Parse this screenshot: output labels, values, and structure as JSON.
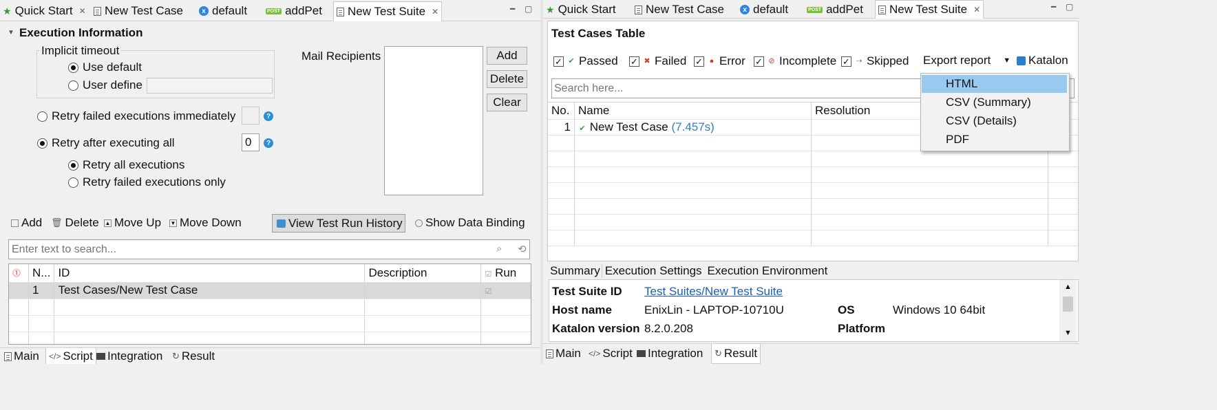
{
  "tabs": [
    {
      "label": "Quick Start",
      "icon": "star-icon",
      "closable": true
    },
    {
      "label": "New Test Case",
      "icon": "test-case-icon",
      "closable": false
    },
    {
      "label": "default",
      "icon": "profile-icon",
      "closable": false
    },
    {
      "label": "addPet",
      "icon": "post-request-icon",
      "closable": false
    },
    {
      "label": "New Test Suite",
      "icon": "test-suite-icon",
      "closable": true
    }
  ],
  "left": {
    "section_title": "Execution Information",
    "implicit_timeout": {
      "legend": "Implicit timeout",
      "use_default": "Use default",
      "user_define": "User define",
      "user_define_value": ""
    },
    "retry_immediately": {
      "label": "Retry failed executions immediately",
      "value": ""
    },
    "retry_after_all": {
      "label": "Retry after executing all",
      "value": "0"
    },
    "retry_all_executions": "Retry all executions",
    "retry_failed_only": "Retry failed executions only",
    "mail": {
      "label": "Mail Recipients",
      "add": "Add",
      "delete": "Delete",
      "clear": "Clear"
    },
    "toolbar": {
      "add": "Add",
      "delete": "Delete",
      "move_up": "Move Up",
      "move_down": "Move Down",
      "view_history": "View Test Run History",
      "show_binding": "Show Data Binding"
    },
    "search_placeholder": "Enter text to search...",
    "table": {
      "headers": {
        "no": "N...",
        "id": "ID",
        "description": "Description",
        "run": "Run"
      },
      "rows": [
        {
          "no": "1",
          "id": "Test Cases/New Test Case",
          "description": ""
        }
      ]
    },
    "bottom_tabs": [
      "Main",
      "Script",
      "Integration",
      "Result"
    ]
  },
  "right": {
    "table_title": "Test Cases Table",
    "filters": {
      "passed": "Passed",
      "failed": "Failed",
      "error": "Error",
      "incomplete": "Incomplete",
      "skipped": "Skipped"
    },
    "export_label": "Export report",
    "katalon_label": "Katalon",
    "search_placeholder": "Search here...",
    "headers": {
      "no": "No.",
      "name": "Name",
      "resolution": "Resolution"
    },
    "rows": [
      {
        "no": "1",
        "name": "New Test Case",
        "duration": "(7.457s)"
      }
    ],
    "export_menu": [
      "HTML",
      "CSV (Summary)",
      "CSV (Details)",
      "PDF"
    ],
    "info_tabs": [
      "Summary",
      "Execution Settings",
      "Execution Environment"
    ],
    "summary": {
      "suite_id_label": "Test Suite ID",
      "suite_id_value": "Test Suites/New Test Suite",
      "host_label": "Host name",
      "host_value": "EnixLin - LAPTOP-10710U",
      "os_label": "OS",
      "os_value": "Windows 10 64bit",
      "version_label": "Katalon version",
      "version_value": "8.2.0.208",
      "platform_label": "Platform",
      "platform_value": ""
    },
    "bottom_tabs": [
      "Main",
      "Script",
      "Integration",
      "Result"
    ]
  },
  "colors": {
    "link": "#1a5fb4",
    "duration": "#2f7fbf",
    "menu_highlight": "#99c9ef",
    "pass": "#3a9a3a",
    "fail": "#d23b2b"
  }
}
